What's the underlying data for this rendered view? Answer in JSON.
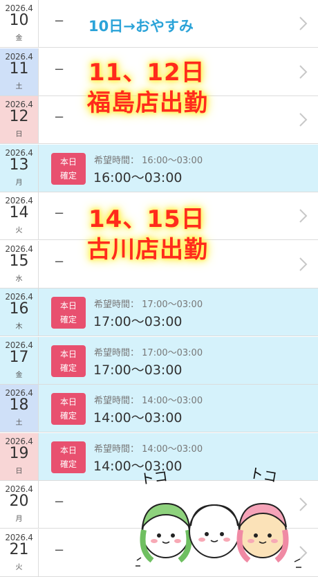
{
  "rows": [
    {
      "year": "2026.4",
      "day": "10",
      "weekday": "金",
      "kind": "weekday",
      "status": "none",
      "dash": "−"
    },
    {
      "year": "2026.4",
      "day": "11",
      "weekday": "土",
      "kind": "sat",
      "status": "none",
      "dash": "−"
    },
    {
      "year": "2026.4",
      "day": "12",
      "weekday": "日",
      "kind": "sun",
      "status": "none",
      "dash": "−"
    },
    {
      "year": "2026.4",
      "day": "13",
      "weekday": "月",
      "kind": "weekday",
      "status": "confirmed",
      "badge_line1": "本日",
      "badge_line2": "確定",
      "wish_label": "希望時間：",
      "wish_time": "16:00〜03:00",
      "confirmed_time": "16:00〜03:00"
    },
    {
      "year": "2026.4",
      "day": "14",
      "weekday": "火",
      "kind": "weekday",
      "status": "none",
      "dash": "−"
    },
    {
      "year": "2026.4",
      "day": "15",
      "weekday": "水",
      "kind": "weekday",
      "status": "none",
      "dash": "−"
    },
    {
      "year": "2026.4",
      "day": "16",
      "weekday": "木",
      "kind": "weekday",
      "status": "confirmed",
      "badge_line1": "本日",
      "badge_line2": "確定",
      "wish_label": "希望時間：",
      "wish_time": "17:00〜03:00",
      "confirmed_time": "17:00〜03:00"
    },
    {
      "year": "2026.4",
      "day": "17",
      "weekday": "金",
      "kind": "weekday",
      "status": "confirmed",
      "badge_line1": "本日",
      "badge_line2": "確定",
      "wish_label": "希望時間：",
      "wish_time": "17:00〜03:00",
      "confirmed_time": "17:00〜03:00"
    },
    {
      "year": "2026.4",
      "day": "18",
      "weekday": "土",
      "kind": "sat",
      "status": "confirmed",
      "badge_line1": "本日",
      "badge_line2": "確定",
      "wish_label": "希望時間：",
      "wish_time": "14:00〜03:00",
      "confirmed_time": "14:00〜03:00"
    },
    {
      "year": "2026.4",
      "day": "19",
      "weekday": "日",
      "kind": "sun",
      "status": "confirmed",
      "badge_line1": "本日",
      "badge_line2": "確定",
      "wish_label": "希望時間：",
      "wish_time": "14:00〜03:00",
      "confirmed_time": "14:00〜03:00"
    },
    {
      "year": "2026.4",
      "day": "20",
      "weekday": "月",
      "kind": "weekday",
      "status": "none",
      "dash": "−"
    },
    {
      "year": "2026.4",
      "day": "21",
      "weekday": "火",
      "kind": "weekday",
      "status": "none",
      "dash": "−"
    }
  ],
  "overlays": {
    "note_rest": "10日→おやすみ",
    "fukushima_dates": "11、12日",
    "fukushima_text": "福島店出勤",
    "furukawa_dates": "14、15日",
    "furukawa_text": "古川店出勤",
    "sticker_text_left": "トコ",
    "sticker_text_right": "トコ"
  },
  "colors": {
    "confirmed_bg": "#d5f2fb",
    "badge": "#e8506f",
    "saturday_bg": "#cfe0f8",
    "sunday_bg": "#f8d6d6",
    "note_blue": "#2ba3d8",
    "note_red": "#ff2b1c"
  },
  "icons": {
    "row_arrow": "chevron-right-icon"
  }
}
